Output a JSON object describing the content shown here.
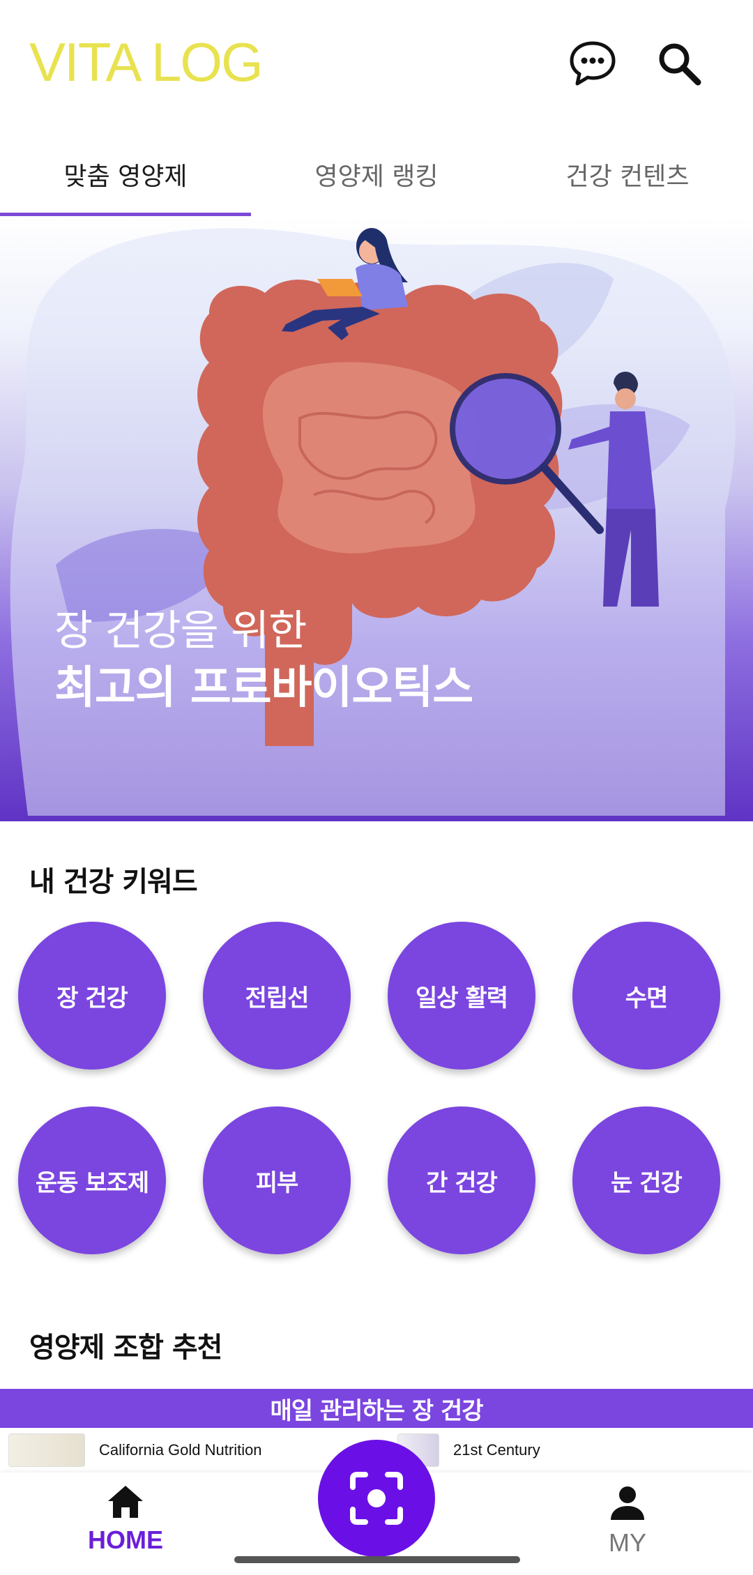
{
  "app": {
    "logo": "VITA LOG"
  },
  "header": {
    "icons": [
      "chat-icon",
      "search-icon"
    ]
  },
  "tabs": [
    {
      "label": "맞춤 영양제",
      "active": true
    },
    {
      "label": "영양제 랭킹",
      "active": false
    },
    {
      "label": "건강 컨텐츠",
      "active": false
    }
  ],
  "banner": {
    "line1": "장 건강을 위한",
    "line2": "최고의 프로바이오틱스"
  },
  "keywords": {
    "title": "내 건강 키워드",
    "items": [
      "장 건강",
      "전립선",
      "일상 활력",
      "수면",
      "운동 보조제",
      "피부",
      "간 건강",
      "눈 건강"
    ]
  },
  "combos": {
    "title": "영양제 조합 추천",
    "bar_label": "매일 관리하는 장 건강",
    "products": [
      "California Gold Nutrition",
      "21st Century"
    ]
  },
  "bottom_nav": {
    "home": "HOME",
    "my": "MY"
  },
  "colors": {
    "logo": "#e8e250",
    "accent": "#7b45e0",
    "scan_button": "#6a10e6",
    "active_nav": "#6a1fd8"
  }
}
